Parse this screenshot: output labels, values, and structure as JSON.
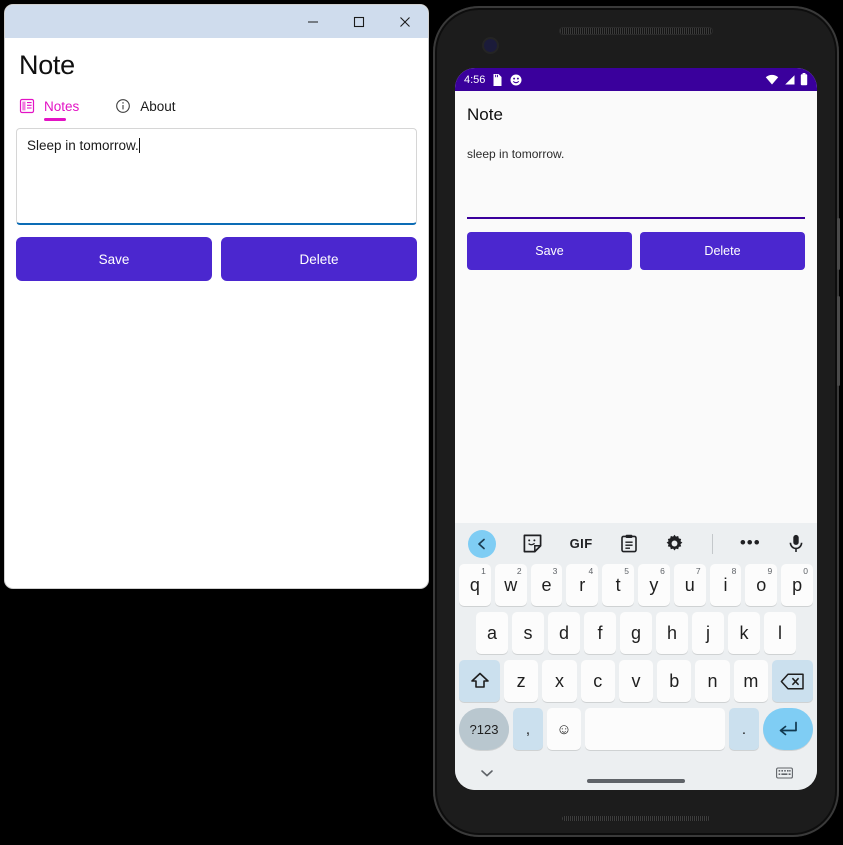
{
  "desktop_window": {
    "title": "Note",
    "controls": {
      "minimize": "minimize-icon",
      "maximize": "maximize-icon",
      "close": "close-icon"
    },
    "tabs": [
      {
        "label": "Notes",
        "icon": "list-icon",
        "active": true
      },
      {
        "label": "About",
        "icon": "info-icon",
        "active": false
      }
    ],
    "note_text": "Sleep in tomorrow.",
    "buttons": {
      "save": "Save",
      "delete": "Delete"
    },
    "accent_color": "#E313C4",
    "button_color": "#4B27CF",
    "focus_underline_color": "#0c6cb5",
    "titlebar_color": "#cfdced"
  },
  "phone": {
    "status_bar": {
      "time": "4:56",
      "left_icons": [
        "sd-card-icon",
        "emoji-face-icon"
      ],
      "right_icons": [
        "wifi-icon",
        "signal-icon",
        "battery-icon"
      ],
      "background_color": "#3A009C"
    },
    "app": {
      "title": "Note",
      "note_text": "sleep in tomorrow.",
      "field_underline_color": "#3A009C",
      "buttons": {
        "save": "Save",
        "delete": "Delete"
      },
      "button_color": "#4B27CF"
    },
    "keyboard": {
      "toolbar": [
        {
          "name": "back-chevron-icon",
          "label": ""
        },
        {
          "name": "sticker-icon",
          "label": ""
        },
        {
          "name": "gif-icon",
          "label": "GIF"
        },
        {
          "name": "clipboard-icon",
          "label": ""
        },
        {
          "name": "gear-icon",
          "label": ""
        },
        {
          "name": "toolbar-divider",
          "label": ""
        },
        {
          "name": "more-options-icon",
          "label": "•••"
        },
        {
          "name": "microphone-icon",
          "label": ""
        }
      ],
      "row1": [
        {
          "key": "q",
          "num": "1"
        },
        {
          "key": "w",
          "num": "2"
        },
        {
          "key": "e",
          "num": "3"
        },
        {
          "key": "r",
          "num": "4"
        },
        {
          "key": "t",
          "num": "5"
        },
        {
          "key": "y",
          "num": "6"
        },
        {
          "key": "u",
          "num": "7"
        },
        {
          "key": "i",
          "num": "8"
        },
        {
          "key": "o",
          "num": "9"
        },
        {
          "key": "p",
          "num": "0"
        }
      ],
      "row2": [
        "a",
        "s",
        "d",
        "f",
        "g",
        "h",
        "j",
        "k",
        "l"
      ],
      "row3": [
        "z",
        "x",
        "c",
        "v",
        "b",
        "n",
        "m"
      ],
      "shift_key": "shift-icon",
      "backspace_key": "backspace-icon",
      "row4": {
        "symbols": "?123",
        "comma": ",",
        "emoji": "☺",
        "space": "",
        "period": ".",
        "enter": "enter-icon"
      },
      "nav": {
        "hide_keyboard": "chevron-down-icon",
        "home_indicator": "home-pill",
        "switch_keyboard": "keyboard-switch-icon"
      },
      "background_color": "#ECEFF1",
      "key_color": "#FCFCFC",
      "accent_key_color": "#7FCDF4"
    }
  }
}
